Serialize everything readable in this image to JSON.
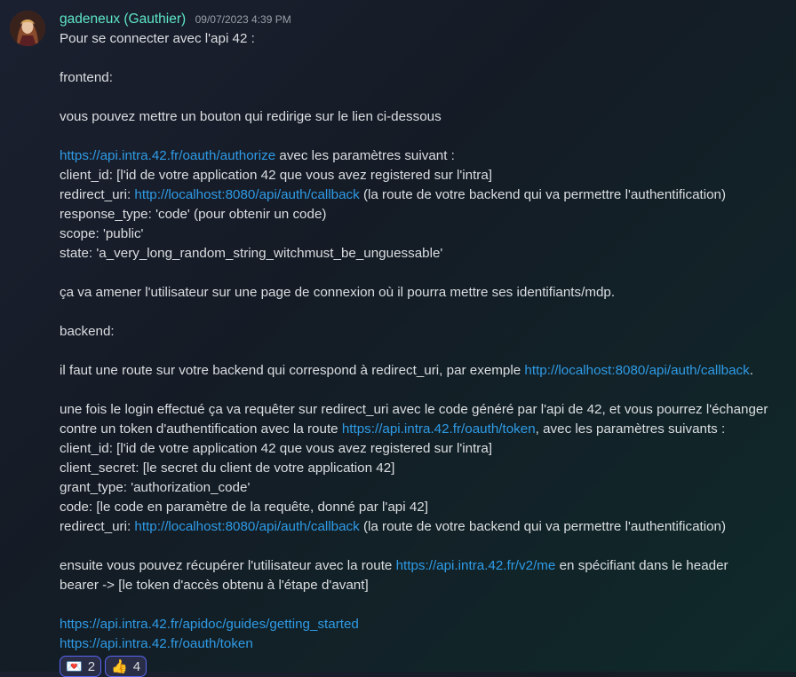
{
  "message": {
    "username": "gadeneux (Gauthier)",
    "timestamp": "09/07/2023 4:39 PM",
    "lines": [
      [
        {
          "t": "Pour se connecter avec l'api 42 :"
        }
      ],
      [],
      [
        {
          "t": "frontend:"
        }
      ],
      [],
      [
        {
          "t": "vous pouvez mettre un bouton qui redirige sur le lien ci-dessous"
        }
      ],
      [],
      [
        {
          "t": "https://api.intra.42.fr/oauth/authorize",
          "link": true
        },
        {
          "t": " avec les paramètres suivant :"
        }
      ],
      [
        {
          "t": "client_id: [l'id de votre application 42 que vous avez registered sur l'intra]"
        }
      ],
      [
        {
          "t": "redirect_uri: "
        },
        {
          "t": "http://localhost:8080/api/auth/callback",
          "link": true
        },
        {
          "t": " (la route de votre backend qui va permettre l'authentification)"
        }
      ],
      [
        {
          "t": "response_type: 'code' (pour obtenir un code)"
        }
      ],
      [
        {
          "t": "scope: 'public'"
        }
      ],
      [
        {
          "t": "state: 'a_very_long_random_string_witchmust_be_unguessable'"
        }
      ],
      [],
      [
        {
          "t": "ça va amener l'utilisateur sur une page de connexion où il pourra mettre ses identifiants/mdp."
        }
      ],
      [],
      [
        {
          "t": "backend:"
        }
      ],
      [],
      [
        {
          "t": "il faut une route sur votre backend qui correspond à redirect_uri, par exemple "
        },
        {
          "t": "http://localhost:8080/api/auth/callback",
          "link": true
        },
        {
          "t": "."
        }
      ],
      [],
      [
        {
          "t": "une fois le login effectué ça va requêter sur redirect_uri avec le code généré par l'api de 42, et vous pourrez l'échanger"
        }
      ],
      [
        {
          "t": "contre un token d'authentification avec la route "
        },
        {
          "t": "https://api.intra.42.fr/oauth/token",
          "link": true
        },
        {
          "t": ", avec les paramètres suivants :"
        }
      ],
      [
        {
          "t": "client_id: [l'id de votre application 42 que vous avez registered sur l'intra]"
        }
      ],
      [
        {
          "t": "client_secret: [le secret du client de votre application 42]"
        }
      ],
      [
        {
          "t": "grant_type: 'authorization_code'"
        }
      ],
      [
        {
          "t": "code: [le code en paramètre de la requête, donné par l'api 42]"
        }
      ],
      [
        {
          "t": "redirect_uri: "
        },
        {
          "t": "http://localhost:8080/api/auth/callback",
          "link": true
        },
        {
          "t": " (la route de votre backend qui va permettre l'authentification)"
        }
      ],
      [],
      [
        {
          "t": "ensuite vous pouvez récupérer l'utilisateur avec la route "
        },
        {
          "t": "https://api.intra.42.fr/v2/me",
          "link": true
        },
        {
          "t": " en spécifiant dans le header"
        }
      ],
      [
        {
          "t": "bearer -> [le token d'accès obtenu à l'étape d'avant]"
        }
      ],
      [],
      [
        {
          "t": "https://api.intra.42.fr/apidoc/guides/getting_started",
          "link": true
        }
      ],
      [
        {
          "t": "https://api.intra.42.fr/oauth/token",
          "link": true
        }
      ]
    ]
  },
  "reactions": [
    {
      "emoji": "💌",
      "count": "2"
    },
    {
      "emoji": "👍",
      "count": "4"
    }
  ],
  "colors": {
    "username": "#5ee6c8",
    "link": "#2f9be6",
    "text": "#dbdee1",
    "timestamp": "#9aa0a8"
  }
}
